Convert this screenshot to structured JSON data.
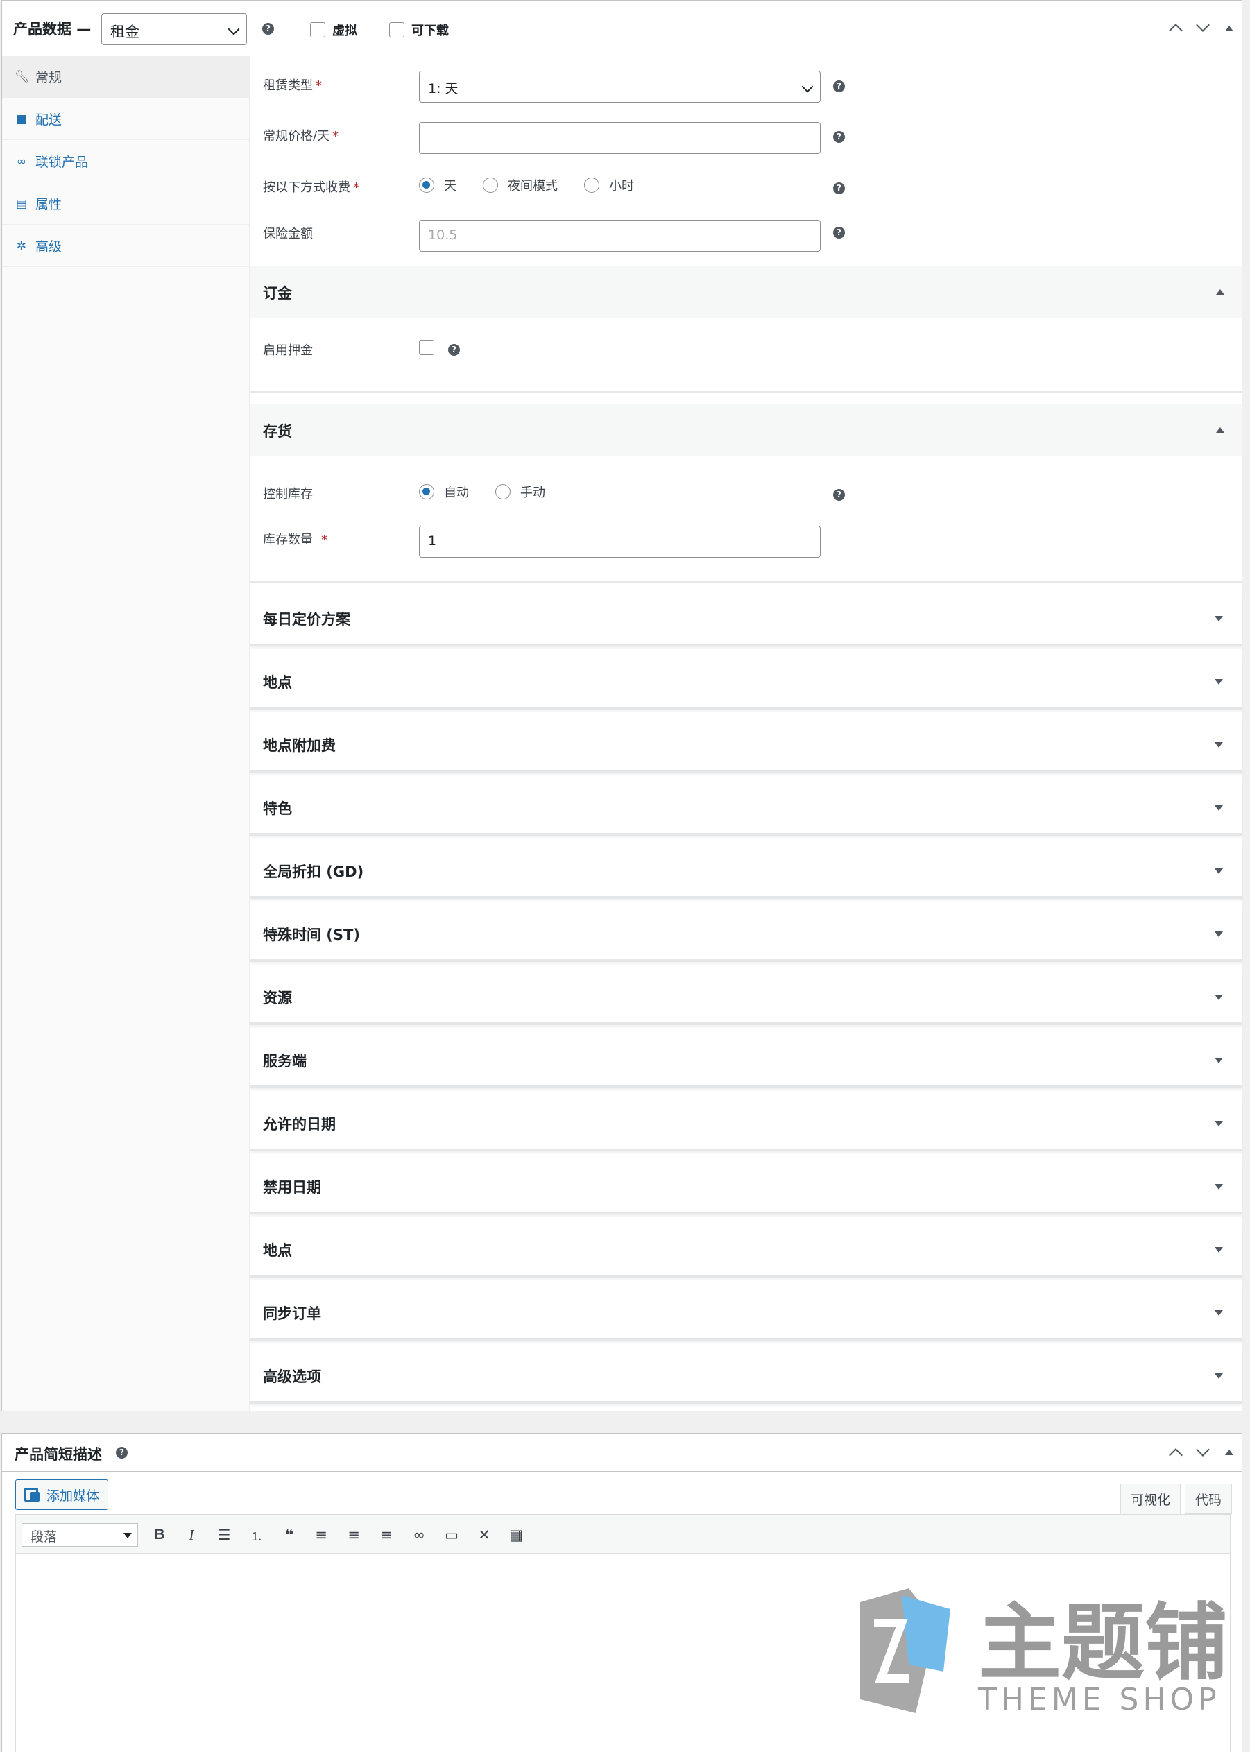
{
  "product_data": {
    "title": "产品数据 —",
    "product_type": "租金",
    "virtual_label": "虚拟",
    "downloadable_label": "可下载",
    "tabs": [
      {
        "label": "常规",
        "icon": "wrench-icon",
        "active": true
      },
      {
        "label": "配送",
        "icon": "truck-icon"
      },
      {
        "label": "联锁产品",
        "icon": "link-icon"
      },
      {
        "label": "属性",
        "icon": "list-icon"
      },
      {
        "label": "高级",
        "icon": "gear-icon"
      }
    ],
    "fields": {
      "rental_type_label": "租赁类型",
      "rental_type_value": "1: 天",
      "regular_price_label": "常规价格/天",
      "regular_price_value": "",
      "charge_by_label": "按以下方式收费",
      "charge_by_options": [
        "天",
        "夜间模式",
        "小时"
      ],
      "charge_by_selected": "天",
      "insurance_label": "保险金额",
      "insurance_placeholder": "10.5",
      "required_mark": "*"
    },
    "deposit_section": {
      "title": "订金",
      "enable_label": "启用押金"
    },
    "inventory_section": {
      "title": "存货",
      "manage_stock_label": "控制库存",
      "manage_stock_options": [
        "自动",
        "手动"
      ],
      "manage_stock_selected": "自动",
      "stock_qty_label": "库存数量",
      "stock_qty_value": "1"
    },
    "accordions": [
      "每日定价方案",
      "地点",
      "地点附加费",
      "特色",
      "全局折扣 (GD)",
      "特殊时间 (ST)",
      "资源",
      "服务端",
      "允许的日期",
      "禁用日期",
      "地点",
      "同步订单",
      "高级选项"
    ]
  },
  "short_description": {
    "title": "产品简短描述",
    "add_media_label": "添加媒体",
    "tab_visual": "可视化",
    "tab_code": "代码",
    "format_value": "段落",
    "toolbar_icons": [
      "bold-icon",
      "italic-icon",
      "bullet-list-icon",
      "numbered-list-icon",
      "blockquote-icon",
      "align-left-icon",
      "align-center-icon",
      "align-right-icon",
      "link-icon",
      "read-more-icon",
      "fullscreen-icon",
      "toolbar-toggle-icon"
    ]
  },
  "watermark": {
    "brand": "主题铺",
    "sub": "THEME SHOP"
  },
  "colors": {
    "accent": "#2271b1",
    "required": "#b32d2e",
    "watermark_gray": "#9a9a9a",
    "watermark_blue": "#5aaee6"
  }
}
